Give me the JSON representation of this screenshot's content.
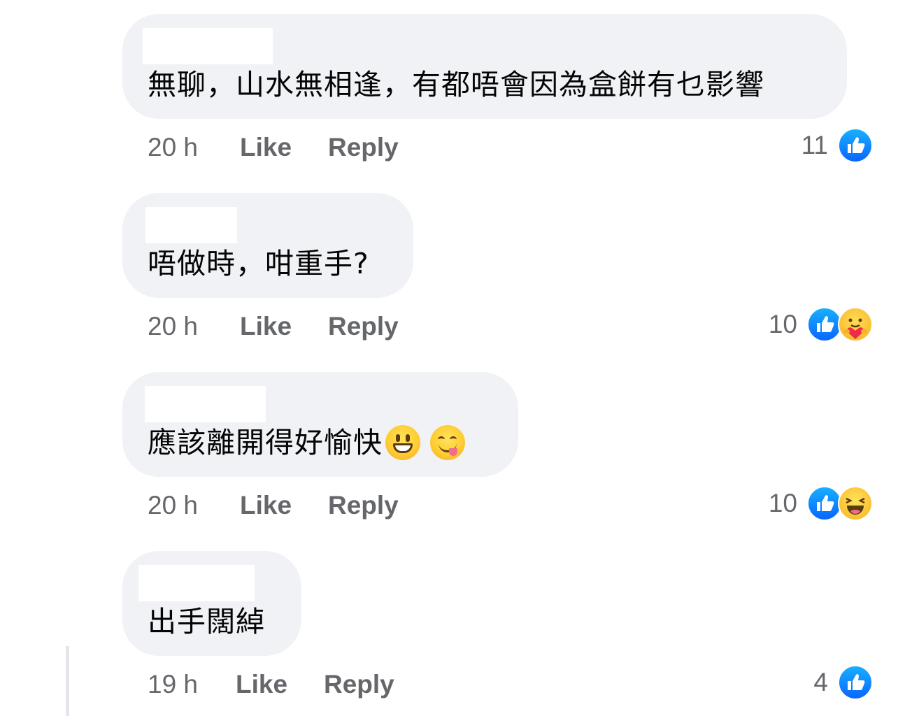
{
  "comments": [
    {
      "text": "無聊，山水無相逢，有都唔會因為盒餅有乜影響",
      "emojis": [],
      "time": "20 h",
      "like_label": "Like",
      "reply_label": "Reply",
      "reaction_count": "11",
      "reactions": [
        "like-icon"
      ]
    },
    {
      "text": "唔做時，咁重手?",
      "emojis": [],
      "time": "20 h",
      "like_label": "Like",
      "reply_label": "Reply",
      "reaction_count": "10",
      "reactions": [
        "like-icon",
        "care-icon"
      ]
    },
    {
      "text": "應該離開得好愉快",
      "emojis": [
        "grinning-face-emoji",
        "yum-face-emoji"
      ],
      "time": "20 h",
      "like_label": "Like",
      "reply_label": "Reply",
      "reaction_count": "10",
      "reactions": [
        "like-icon",
        "haha-icon"
      ]
    },
    {
      "text": "出手闊綽",
      "emojis": [],
      "time": "19 h",
      "like_label": "Like",
      "reply_label": "Reply",
      "reaction_count": "4",
      "reactions": [
        "like-icon"
      ]
    }
  ],
  "colors": {
    "bubble_bg": "#f0f2f5",
    "meta_text": "#65676b",
    "like_blue": "#0866ff",
    "thread_line": "#e4e6eb"
  }
}
